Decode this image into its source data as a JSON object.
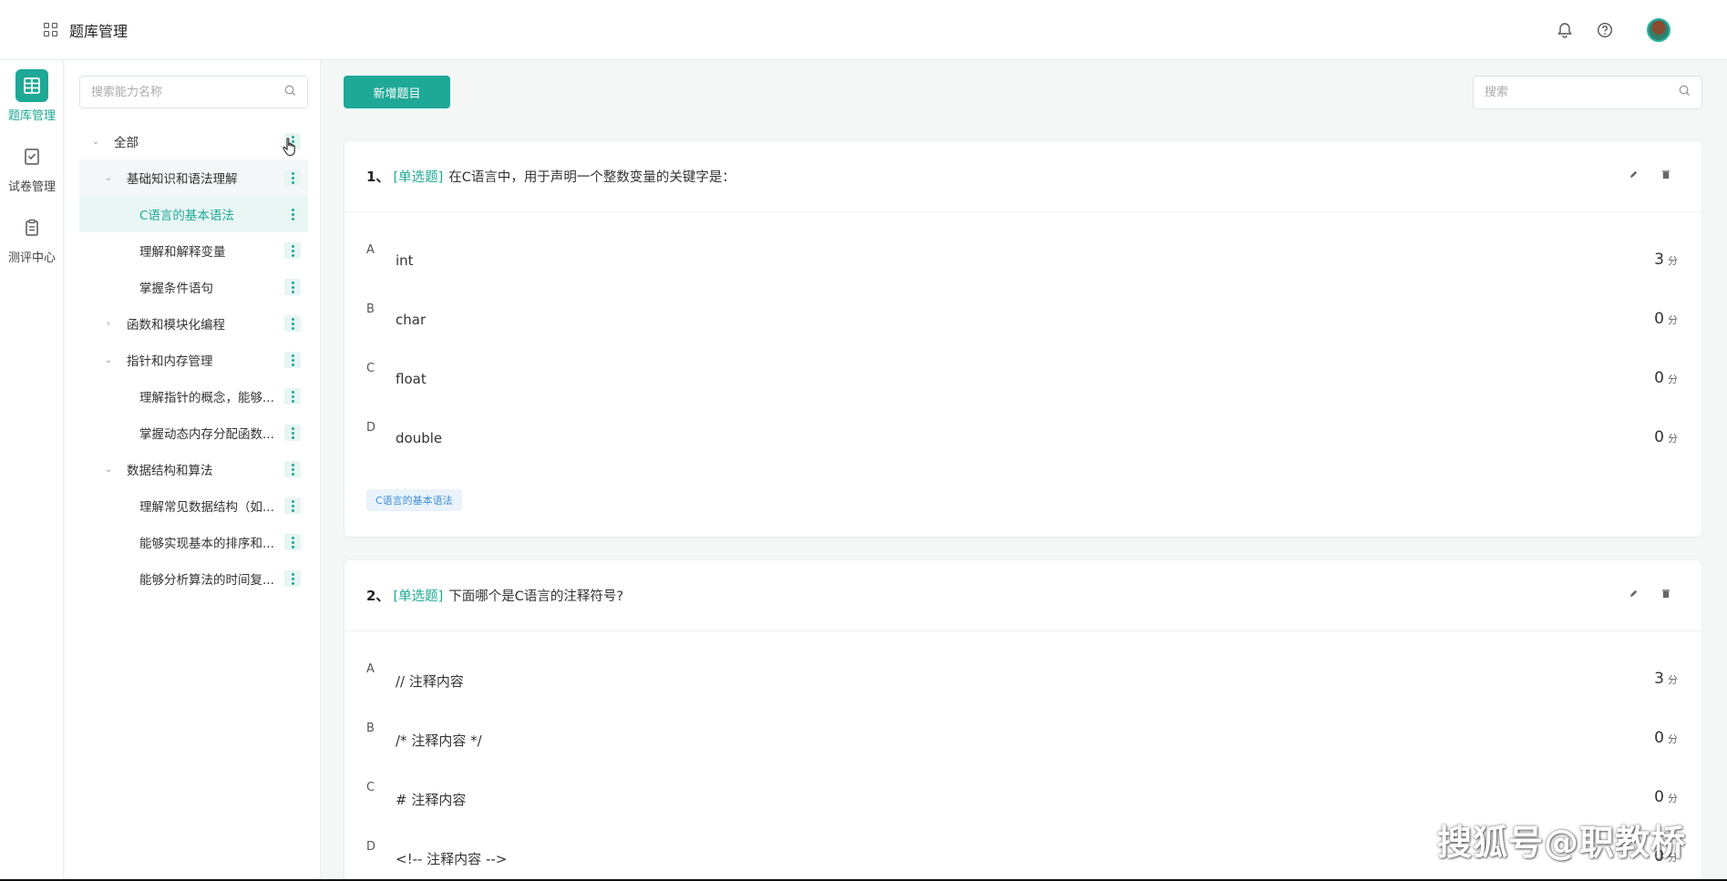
{
  "app": {
    "title": "题库管理"
  },
  "rail": {
    "items": [
      {
        "label": "题库管理",
        "active": true
      },
      {
        "label": "试卷管理",
        "active": false
      },
      {
        "label": "测评中心",
        "active": false
      }
    ]
  },
  "tree": {
    "search_placeholder": "搜索能力名称",
    "nodes": [
      {
        "label": "全部"
      },
      {
        "label": "基础知识和语法理解"
      },
      {
        "label": "C语言的基本语法"
      },
      {
        "label": "理解和解释变量"
      },
      {
        "label": "掌握条件语句"
      },
      {
        "label": "函数和模块化编程"
      },
      {
        "label": "指针和内存管理"
      },
      {
        "label": "理解指针的概念，能够..."
      },
      {
        "label": "掌握动态内存分配函数..."
      },
      {
        "label": "数据结构和算法"
      },
      {
        "label": "理解常见数据结构（如..."
      },
      {
        "label": "能够实现基本的排序和..."
      },
      {
        "label": "能够分析算法的时间复..."
      }
    ]
  },
  "main": {
    "add_button": "新增题目",
    "search_placeholder": "搜索"
  },
  "questions": [
    {
      "num": "1、",
      "type": "[单选题]",
      "text": "在C语言中，用于声明一个整数变量的关键字是：",
      "options": [
        {
          "letter": "A",
          "text": "int",
          "score": "3"
        },
        {
          "letter": "B",
          "text": "char",
          "score": "0"
        },
        {
          "letter": "C",
          "text": "float",
          "score": "0"
        },
        {
          "letter": "D",
          "text": "double",
          "score": "0"
        }
      ],
      "tag": "C语言的基本语法"
    },
    {
      "num": "2、",
      "type": "[单选题]",
      "text": "下面哪个是C语言的注释符号?",
      "options": [
        {
          "letter": "A",
          "text": "// 注释内容",
          "score": "3"
        },
        {
          "letter": "B",
          "text": "/* 注释内容 */",
          "score": "0"
        },
        {
          "letter": "C",
          "text": "# 注释内容",
          "score": "0"
        },
        {
          "letter": "D",
          "text": "<!-- 注释内容 -->",
          "score": "0"
        }
      ]
    }
  ],
  "score_unit": "分",
  "watermark": "搜狐号@职教桥",
  "colors": {
    "accent": "#1ea896",
    "tag_bg": "#eaf3fb",
    "tag_text": "#3c8fd8"
  }
}
